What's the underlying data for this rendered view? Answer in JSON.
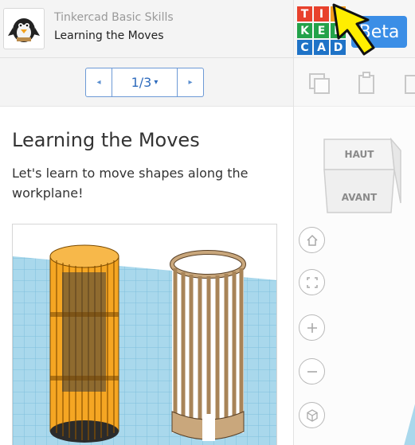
{
  "lesson_header": {
    "course_title": "Tinkercad Basic Skills",
    "lesson_name": "Learning the Moves"
  },
  "pager": {
    "prev_label": "◂",
    "page": "1/3",
    "caret": "▾",
    "next_label": "▸"
  },
  "content": {
    "title": "Learning the Moves",
    "description": "Let's learn to move shapes along the workplane!"
  },
  "logo": {
    "letters": [
      "T",
      "I",
      "N",
      "K",
      "E",
      "R",
      "C",
      "A",
      "D"
    ],
    "colors": [
      "#e8412c",
      "#e8412c",
      "#f39c1f",
      "#23a24a",
      "#23a24a",
      "#23a24a",
      "#1f73c7",
      "#1f73c7",
      "#1f73c7"
    ]
  },
  "beta_label": "Beta",
  "view_cube": {
    "top_face": "HAUT",
    "front_face": "AVANT"
  },
  "nav_controls": [
    "home-icon",
    "fit-view-icon",
    "zoom-in-icon",
    "zoom-out-icon",
    "perspective-icon"
  ],
  "colors": {
    "accent": "#3b8ee6",
    "pager_border": "#6d9ad6",
    "arrow_fill": "#ffee00",
    "orange_model": "#f5a623",
    "brown_model": "#c9a77c",
    "workplane": "#a9d8ec"
  }
}
